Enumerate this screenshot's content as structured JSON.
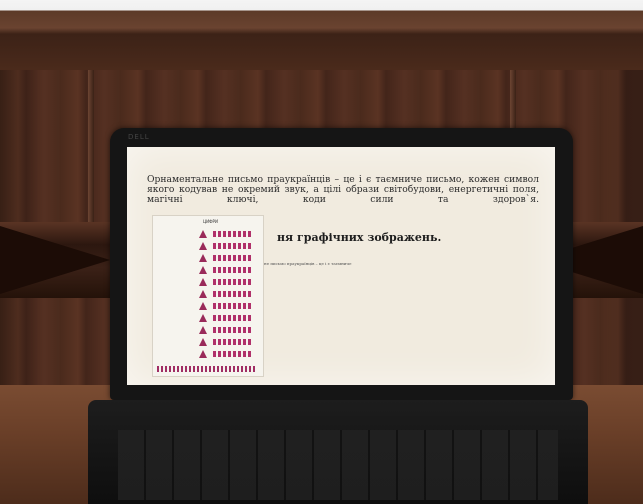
{
  "screen": {
    "paragraph_lines": [
      "Орнаментальне письмо праукраїнців – це і є таємниче письмо, кожен символ",
      "якого кодував не окремий звук, а цілі образи світобудови, енергетичні поля,",
      "магічні ключі, коди сили та здоров`я."
    ],
    "heading": "ня графічних зображень.",
    "caption": "енне письмо праукраїнців – це і є таємниче",
    "figure_title": "ЦИФРИ"
  },
  "laptop": {
    "brand": "DELL"
  },
  "colors": {
    "ornament": "#a02d64",
    "screen_bg": "#f1ebdf"
  }
}
